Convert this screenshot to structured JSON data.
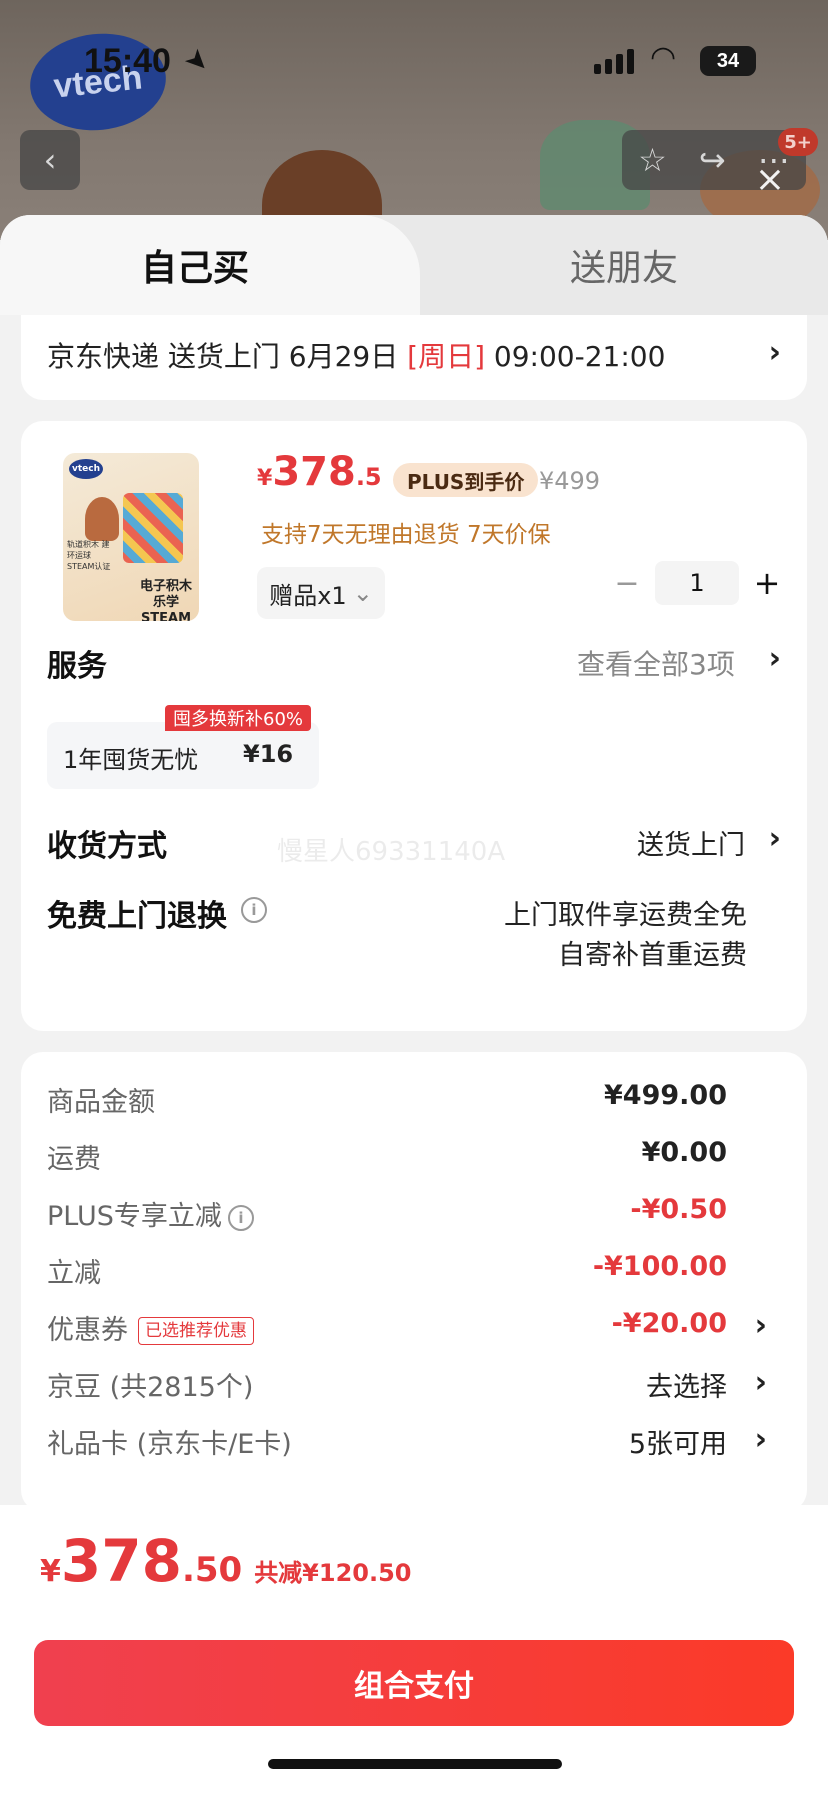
{
  "status_bar": {
    "time": "15:40",
    "battery": "34"
  },
  "background": {
    "brand_logo_text": "vtech",
    "age_badge": "5+"
  },
  "tabs": {
    "active": "自己买",
    "inactive": "送朋友"
  },
  "delivery": {
    "prefix": "京东快递 送货上门 6月29日 ",
    "day": "[周日]",
    "time_range": " 09:00-21:00"
  },
  "product": {
    "image_brand": "vtech",
    "image_caption": "电子积木\n乐学STEAM",
    "image_side_text": "轨道积木 建环运球 STEAM认证",
    "price_symbol": "¥",
    "price_int": "378",
    "price_dec": ".5",
    "plus_tag": "PLUS到手价",
    "original_price": "¥499",
    "guarantee": "支持7天无理由退货  7天价保",
    "gift_label": "赠品x1",
    "quantity": "1"
  },
  "services": {
    "title": "服务",
    "more": "查看全部3项",
    "item_name": "1年囤货无忧",
    "item_price": "¥16",
    "item_badge": "囤多换新补60%"
  },
  "shipping": {
    "label": "收货方式",
    "value": "送货上门",
    "watermark": "慢星人69331140A"
  },
  "free_return": {
    "label": "免费上门退换",
    "line1": "上门取件享运费全免",
    "line2": "自寄补首重运费"
  },
  "summary": {
    "goods_label": "商品金额",
    "goods_value": "¥499.00",
    "freight_label": "运费",
    "freight_value": "¥0.00",
    "plus_label": "PLUS专享立减",
    "plus_value": "-¥0.50",
    "discount_label": "立减",
    "discount_value": "-¥100.00",
    "coupon_label": "优惠券",
    "coupon_tag": "已选推荐优惠",
    "coupon_value": "-¥20.00",
    "jingdou_label": "京豆 (共2815个)",
    "jingdou_value": "去选择",
    "giftcard_label": "礼品卡 (京东卡/E卡)",
    "giftcard_value": "5张可用"
  },
  "total": {
    "symbol": "¥",
    "int": "378",
    "dec": ".50",
    "saved": "共减¥120.50"
  },
  "pay_button": "组合支付",
  "colors": {
    "accent": "#e4393c",
    "plus_bg": "#f9e3cf",
    "guarantee": "#c0772a"
  }
}
